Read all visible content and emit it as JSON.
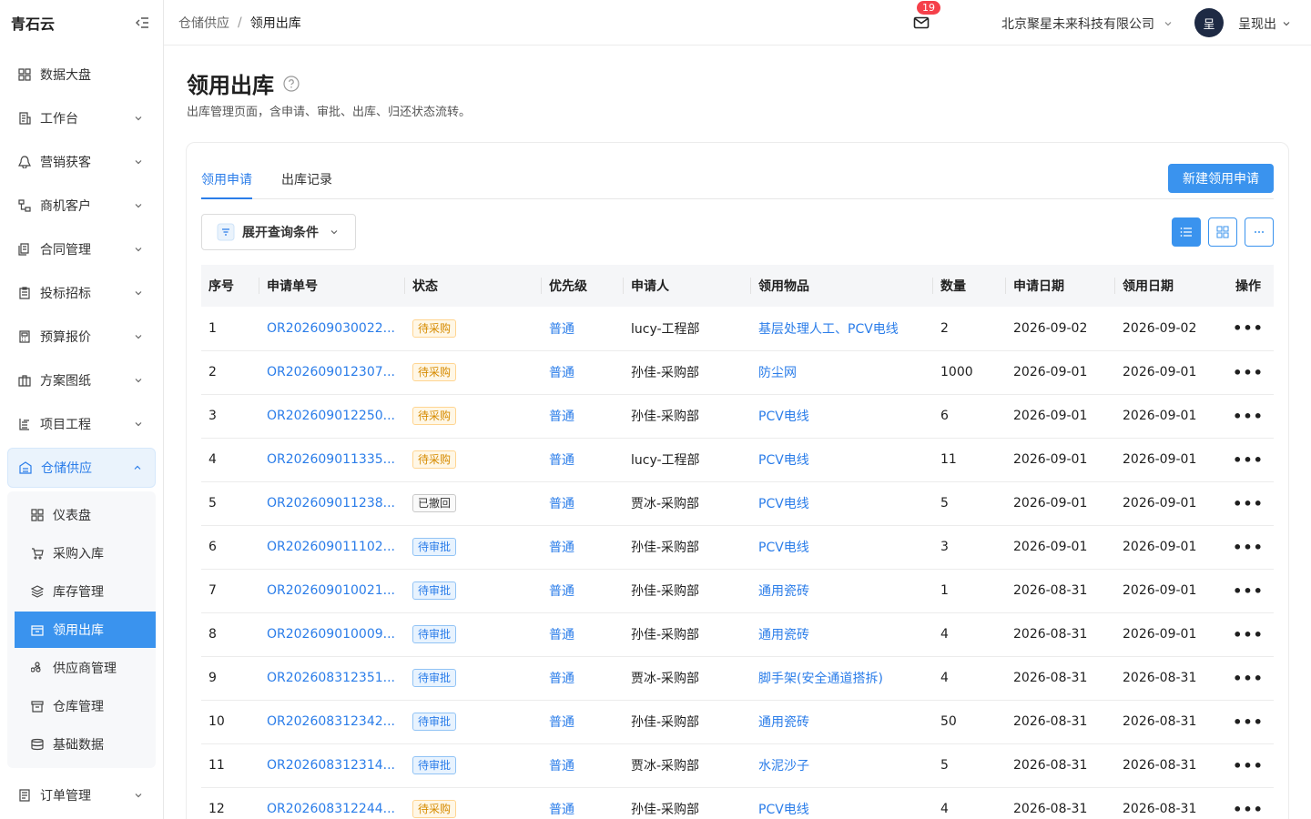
{
  "app": {
    "name": "青石云"
  },
  "sidebar": {
    "items": [
      {
        "label": "数据大盘",
        "icon": "dashboard-icon",
        "expandable": false
      },
      {
        "label": "工作台",
        "icon": "workbench-icon",
        "expandable": true
      },
      {
        "label": "营销获客",
        "icon": "marketing-icon",
        "expandable": true
      },
      {
        "label": "商机客户",
        "icon": "customer-icon",
        "expandable": true
      },
      {
        "label": "合同管理",
        "icon": "contract-icon",
        "expandable": true
      },
      {
        "label": "投标招标",
        "icon": "bid-icon",
        "expandable": true
      },
      {
        "label": "预算报价",
        "icon": "calculator-icon",
        "expandable": true
      },
      {
        "label": "方案图纸",
        "icon": "briefcase-icon",
        "expandable": true
      },
      {
        "label": "项目工程",
        "icon": "project-icon",
        "expandable": true
      },
      {
        "label": "仓储供应",
        "icon": "warehouse-icon",
        "expandable": true,
        "open": true
      },
      {
        "label": "订单管理",
        "icon": "order-icon",
        "expandable": true
      }
    ],
    "submenu": [
      {
        "label": "仪表盘",
        "icon": "grid-icon"
      },
      {
        "label": "采购入库",
        "icon": "cart-icon"
      },
      {
        "label": "库存管理",
        "icon": "layers-icon"
      },
      {
        "label": "领用出库",
        "icon": "outbound-icon",
        "active": true
      },
      {
        "label": "供应商管理",
        "icon": "supplier-icon"
      },
      {
        "label": "仓库管理",
        "icon": "archive-icon"
      },
      {
        "label": "基础数据",
        "icon": "database-icon"
      }
    ]
  },
  "header": {
    "breadcrumb": {
      "parent": "仓储供应",
      "separator": "/",
      "current": "领用出库"
    },
    "notification_count": "19",
    "company": "北京聚星未来科技有限公司",
    "avatar_text": "呈",
    "user_name": "呈现出"
  },
  "page": {
    "title": "领用出库",
    "description": "出库管理页面，含申请、审批、出库、归还状态流转。"
  },
  "tabs": [
    {
      "label": "领用申请",
      "active": true
    },
    {
      "label": "出库记录",
      "active": false
    }
  ],
  "toolbar": {
    "new_button": "新建领用申请",
    "filter_button": "展开查询条件",
    "view_modes": [
      "list-view-icon",
      "grid-view-icon",
      "more-icon"
    ]
  },
  "table": {
    "columns": [
      "序号",
      "申请单号",
      "状态",
      "优先级",
      "申请人",
      "领用物品",
      "数量",
      "申请日期",
      "领用日期",
      "操作"
    ],
    "rows": [
      {
        "no": "1",
        "order": "OR202609030022...",
        "status": "待采购",
        "priority": "普通",
        "applicant": "lucy-工程部",
        "item": "基层处理人工、PCV电线",
        "qty": "2",
        "apply_date": "2026-09-02",
        "receive_date": "2026-09-02",
        "op": "•••"
      },
      {
        "no": "2",
        "order": "OR202609012307...",
        "status": "待采购",
        "priority": "普通",
        "applicant": "孙佳-采购部",
        "item": "防尘网",
        "qty": "1000",
        "apply_date": "2026-09-01",
        "receive_date": "2026-09-01",
        "op": "•••"
      },
      {
        "no": "3",
        "order": "OR202609012250...",
        "status": "待采购",
        "priority": "普通",
        "applicant": "孙佳-采购部",
        "item": "PCV电线",
        "qty": "6",
        "apply_date": "2026-09-01",
        "receive_date": "2026-09-01",
        "op": "•••"
      },
      {
        "no": "4",
        "order": "OR202609011335...",
        "status": "待采购",
        "priority": "普通",
        "applicant": "lucy-工程部",
        "item": "PCV电线",
        "qty": "11",
        "apply_date": "2026-09-01",
        "receive_date": "2026-09-01",
        "op": "•••"
      },
      {
        "no": "5",
        "order": "OR202609011238...",
        "status": "已撤回",
        "priority": "普通",
        "applicant": "贾冰-采购部",
        "item": "PCV电线",
        "qty": "5",
        "apply_date": "2026-09-01",
        "receive_date": "2026-09-01",
        "op": "•••"
      },
      {
        "no": "6",
        "order": "OR202609011102...",
        "status": "待审批",
        "priority": "普通",
        "applicant": "孙佳-采购部",
        "item": "PCV电线",
        "qty": "3",
        "apply_date": "2026-09-01",
        "receive_date": "2026-09-01",
        "op": "•••"
      },
      {
        "no": "7",
        "order": "OR202609010021...",
        "status": "待审批",
        "priority": "普通",
        "applicant": "孙佳-采购部",
        "item": "通用瓷砖",
        "qty": "1",
        "apply_date": "2026-08-31",
        "receive_date": "2026-09-01",
        "op": "•••"
      },
      {
        "no": "8",
        "order": "OR202609010009...",
        "status": "待审批",
        "priority": "普通",
        "applicant": "孙佳-采购部",
        "item": "通用瓷砖",
        "qty": "4",
        "apply_date": "2026-08-31",
        "receive_date": "2026-09-01",
        "op": "•••"
      },
      {
        "no": "9",
        "order": "OR202608312351...",
        "status": "待审批",
        "priority": "普通",
        "applicant": "贾冰-采购部",
        "item": "脚手架(安全通道搭拆)",
        "qty": "4",
        "apply_date": "2026-08-31",
        "receive_date": "2026-08-31",
        "op": "•••"
      },
      {
        "no": "10",
        "order": "OR202608312342...",
        "status": "待审批",
        "priority": "普通",
        "applicant": "孙佳-采购部",
        "item": "通用瓷砖",
        "qty": "50",
        "apply_date": "2026-08-31",
        "receive_date": "2026-08-31",
        "op": "•••"
      },
      {
        "no": "11",
        "order": "OR202608312314...",
        "status": "待审批",
        "priority": "普通",
        "applicant": "贾冰-采购部",
        "item": "水泥沙子",
        "qty": "5",
        "apply_date": "2026-08-31",
        "receive_date": "2026-08-31",
        "op": "•••"
      },
      {
        "no": "12",
        "order": "OR202608312244...",
        "status": "待采购",
        "priority": "普通",
        "applicant": "孙佳-采购部",
        "item": "PCV电线",
        "qty": "4",
        "apply_date": "2026-08-31",
        "receive_date": "2026-08-31",
        "op": "•••"
      }
    ]
  },
  "colors": {
    "accent": "#3a93ee",
    "link": "#2b7de9",
    "status_purchase": "#d68b00",
    "status_review": "#2b7de9",
    "status_withdrawn": "#333333",
    "badge": "#f5404a"
  }
}
